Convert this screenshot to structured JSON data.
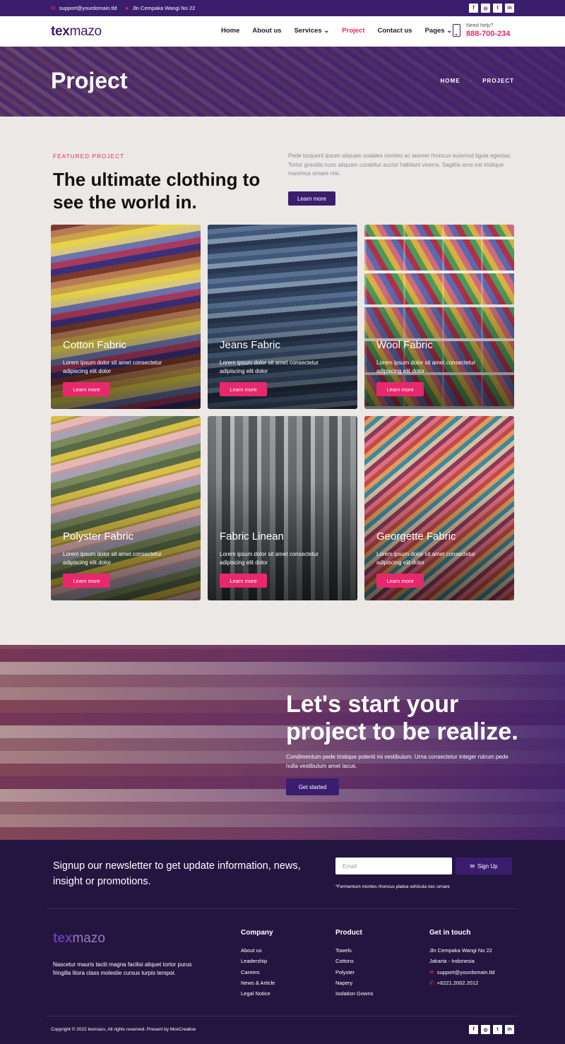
{
  "topbar": {
    "email": "support@yourdomain.tld",
    "address": "Jln Cempaka Wangi No 22",
    "socials": [
      "facebook-icon",
      "instagram-icon",
      "twitter-icon",
      "linkedin-icon"
    ]
  },
  "nav": {
    "logo_bold": "tex",
    "logo_light": "mazo",
    "items": [
      {
        "label": "Home"
      },
      {
        "label": "About us"
      },
      {
        "label": "Services"
      },
      {
        "label": "Project"
      },
      {
        "label": "Contact us"
      },
      {
        "label": "Pages"
      }
    ],
    "need_help": "Need help?",
    "phone": "888-700-234"
  },
  "hero": {
    "title": "Project",
    "crumb_home": "HOME",
    "crumb_current": "PROJECT"
  },
  "featured": {
    "label": "FEATURED PROJECT",
    "title": "The ultimate clothing to see the world in.",
    "text": "Pede torquent ipsum aliquam sodales montes ac laoreet rhoncus euismod ligula egestas. Tortor gravida nunc aliquam curabitur auctor habitant viverra. Sagittis eros est tristique maximus ornare nisi.",
    "button": "Learn more"
  },
  "projects": [
    {
      "title": "Cotton Fabric",
      "desc": "Lorem ipsum dolor sit amet consectetur adipiscing elit dolor",
      "button": "Learn more"
    },
    {
      "title": "Jeans Fabric",
      "desc": "Lorem ipsum dolor sit amet consectetur adipiscing elit dolor",
      "button": "Learn more"
    },
    {
      "title": "Wool Fabric",
      "desc": "Lorem ipsum dolor sit amet consectetur adipiscing elit dolor",
      "button": "Learn more"
    },
    {
      "title": "Polyster Fabric",
      "desc": "Lorem ipsum dolor sit amet consectetur adipiscing elit dolor",
      "button": "Learn more"
    },
    {
      "title": "Fabric Linean",
      "desc": "Lorem ipsum dolor sit amet consectetur adipiscing elit dolor",
      "button": "Learn more"
    },
    {
      "title": "Georgette Fabric",
      "desc": "Lorem ipsum dolor sit amet consectetur adipiscing elit dolor",
      "button": "Learn more"
    }
  ],
  "cta": {
    "title": "Let's start your project to be realize.",
    "text": "Condimentum pede tristique potenti mi vestibulum. Urna consectetur integer rutrum pede nulla vestibulum amet lacus.",
    "button": "Get started"
  },
  "newsletter": {
    "text": "Signup our newsletter to get update information, news, insight or promotions.",
    "placeholder": "Email",
    "button": "Sign Up",
    "note": "*Fermentum montes rhoncus platea vehicula nec ornare"
  },
  "footer": {
    "logo_bold": "tex",
    "logo_light": "mazo",
    "description": "Nascetur mauris taciti magna facilisi aliquet tortor purus fringilla litora class molestie cursus turpis tempor.",
    "company": {
      "title": "Company",
      "links": [
        "About us",
        "Leadership",
        "Careers",
        "News & Article",
        "Legal Notice"
      ]
    },
    "product": {
      "title": "Product",
      "links": [
        "Towels",
        "Cottons",
        "Polyster",
        "Napery",
        "Isolation Gowns"
      ]
    },
    "contact": {
      "title": "Get in touch",
      "address1": "Jln Cempaka Wangi No 22",
      "address2": "Jakarta - Indonesia",
      "email": "support@yourdomain.tld",
      "phone": "+6221.2002.2012"
    },
    "copyright": "Copyright © 2022 texmazo, All rights reserved. Present by MoxCreative"
  },
  "colors": {
    "primary": "#3b1d6e",
    "accent": "#e8286c",
    "footer_bg": "#241540",
    "page_bg": "#ece8e6"
  }
}
